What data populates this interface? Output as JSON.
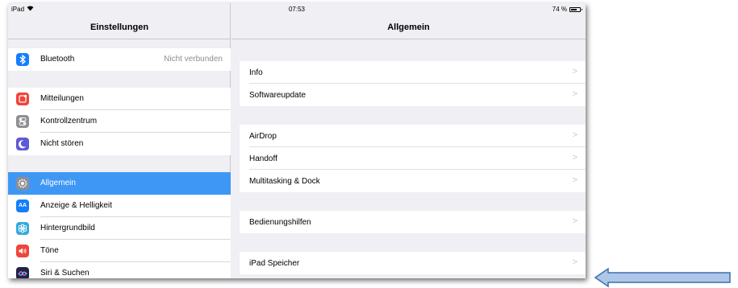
{
  "status_bar": {
    "device": "iPad",
    "time": "07:53",
    "battery": "74 %",
    "battery_level": 0.74
  },
  "sidebar": {
    "title": "Einstellungen",
    "items": [
      {
        "label": "Bluetooth",
        "value": "Nicht verbunden",
        "icon": "bluetooth-icon",
        "color": "#147efb"
      },
      {
        "label": "Mitteilungen",
        "icon": "notifications-icon",
        "color": "#f0453a"
      },
      {
        "label": "Kontrollzentrum",
        "icon": "control-center-icon",
        "color": "#8e8e93"
      },
      {
        "label": "Nicht stören",
        "icon": "moon-icon",
        "color": "#5d5ad6"
      },
      {
        "label": "Allgemein",
        "icon": "gear-icon",
        "color": "#8e8e93",
        "selected": true
      },
      {
        "label": "Anzeige & Helligkeit",
        "icon": "display-brightness-icon",
        "color": "#147efb"
      },
      {
        "label": "Hintergrundbild",
        "icon": "wallpaper-icon",
        "color": "#35aadc"
      },
      {
        "label": "Töne",
        "icon": "sounds-icon",
        "color": "#f0453a"
      },
      {
        "label": "Siri & Suchen",
        "icon": "siri-icon",
        "color": "#222244"
      }
    ],
    "selected_color": "#3f97f5"
  },
  "detail": {
    "title": "Allgemein",
    "items": [
      {
        "label": "Info"
      },
      {
        "label": "Softwareupdate"
      },
      {
        "label": "AirDrop"
      },
      {
        "label": "Handoff"
      },
      {
        "label": "Multitasking & Dock"
      },
      {
        "label": "Bedienungshilfen"
      },
      {
        "label": "iPad Speicher"
      }
    ],
    "chevron": ">"
  },
  "annotation": {
    "arrow_fill": "#aec6e8",
    "arrow_stroke": "#3b6faf",
    "direction": "left"
  }
}
